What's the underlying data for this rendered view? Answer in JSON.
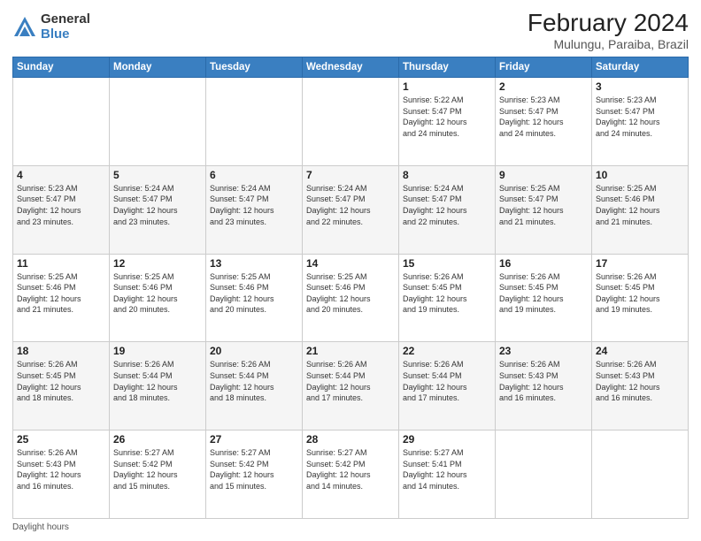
{
  "logo": {
    "general": "General",
    "blue": "Blue"
  },
  "title": {
    "month_year": "February 2024",
    "location": "Mulungu, Paraiba, Brazil"
  },
  "days_of_week": [
    "Sunday",
    "Monday",
    "Tuesday",
    "Wednesday",
    "Thursday",
    "Friday",
    "Saturday"
  ],
  "weeks": [
    [
      {
        "day": "",
        "info": ""
      },
      {
        "day": "",
        "info": ""
      },
      {
        "day": "",
        "info": ""
      },
      {
        "day": "",
        "info": ""
      },
      {
        "day": "1",
        "info": "Sunrise: 5:22 AM\nSunset: 5:47 PM\nDaylight: 12 hours\nand 24 minutes."
      },
      {
        "day": "2",
        "info": "Sunrise: 5:23 AM\nSunset: 5:47 PM\nDaylight: 12 hours\nand 24 minutes."
      },
      {
        "day": "3",
        "info": "Sunrise: 5:23 AM\nSunset: 5:47 PM\nDaylight: 12 hours\nand 24 minutes."
      }
    ],
    [
      {
        "day": "4",
        "info": "Sunrise: 5:23 AM\nSunset: 5:47 PM\nDaylight: 12 hours\nand 23 minutes."
      },
      {
        "day": "5",
        "info": "Sunrise: 5:24 AM\nSunset: 5:47 PM\nDaylight: 12 hours\nand 23 minutes."
      },
      {
        "day": "6",
        "info": "Sunrise: 5:24 AM\nSunset: 5:47 PM\nDaylight: 12 hours\nand 23 minutes."
      },
      {
        "day": "7",
        "info": "Sunrise: 5:24 AM\nSunset: 5:47 PM\nDaylight: 12 hours\nand 22 minutes."
      },
      {
        "day": "8",
        "info": "Sunrise: 5:24 AM\nSunset: 5:47 PM\nDaylight: 12 hours\nand 22 minutes."
      },
      {
        "day": "9",
        "info": "Sunrise: 5:25 AM\nSunset: 5:47 PM\nDaylight: 12 hours\nand 21 minutes."
      },
      {
        "day": "10",
        "info": "Sunrise: 5:25 AM\nSunset: 5:46 PM\nDaylight: 12 hours\nand 21 minutes."
      }
    ],
    [
      {
        "day": "11",
        "info": "Sunrise: 5:25 AM\nSunset: 5:46 PM\nDaylight: 12 hours\nand 21 minutes."
      },
      {
        "day": "12",
        "info": "Sunrise: 5:25 AM\nSunset: 5:46 PM\nDaylight: 12 hours\nand 20 minutes."
      },
      {
        "day": "13",
        "info": "Sunrise: 5:25 AM\nSunset: 5:46 PM\nDaylight: 12 hours\nand 20 minutes."
      },
      {
        "day": "14",
        "info": "Sunrise: 5:25 AM\nSunset: 5:46 PM\nDaylight: 12 hours\nand 20 minutes."
      },
      {
        "day": "15",
        "info": "Sunrise: 5:26 AM\nSunset: 5:45 PM\nDaylight: 12 hours\nand 19 minutes."
      },
      {
        "day": "16",
        "info": "Sunrise: 5:26 AM\nSunset: 5:45 PM\nDaylight: 12 hours\nand 19 minutes."
      },
      {
        "day": "17",
        "info": "Sunrise: 5:26 AM\nSunset: 5:45 PM\nDaylight: 12 hours\nand 19 minutes."
      }
    ],
    [
      {
        "day": "18",
        "info": "Sunrise: 5:26 AM\nSunset: 5:45 PM\nDaylight: 12 hours\nand 18 minutes."
      },
      {
        "day": "19",
        "info": "Sunrise: 5:26 AM\nSunset: 5:44 PM\nDaylight: 12 hours\nand 18 minutes."
      },
      {
        "day": "20",
        "info": "Sunrise: 5:26 AM\nSunset: 5:44 PM\nDaylight: 12 hours\nand 18 minutes."
      },
      {
        "day": "21",
        "info": "Sunrise: 5:26 AM\nSunset: 5:44 PM\nDaylight: 12 hours\nand 17 minutes."
      },
      {
        "day": "22",
        "info": "Sunrise: 5:26 AM\nSunset: 5:44 PM\nDaylight: 12 hours\nand 17 minutes."
      },
      {
        "day": "23",
        "info": "Sunrise: 5:26 AM\nSunset: 5:43 PM\nDaylight: 12 hours\nand 16 minutes."
      },
      {
        "day": "24",
        "info": "Sunrise: 5:26 AM\nSunset: 5:43 PM\nDaylight: 12 hours\nand 16 minutes."
      }
    ],
    [
      {
        "day": "25",
        "info": "Sunrise: 5:26 AM\nSunset: 5:43 PM\nDaylight: 12 hours\nand 16 minutes."
      },
      {
        "day": "26",
        "info": "Sunrise: 5:27 AM\nSunset: 5:42 PM\nDaylight: 12 hours\nand 15 minutes."
      },
      {
        "day": "27",
        "info": "Sunrise: 5:27 AM\nSunset: 5:42 PM\nDaylight: 12 hours\nand 15 minutes."
      },
      {
        "day": "28",
        "info": "Sunrise: 5:27 AM\nSunset: 5:42 PM\nDaylight: 12 hours\nand 14 minutes."
      },
      {
        "day": "29",
        "info": "Sunrise: 5:27 AM\nSunset: 5:41 PM\nDaylight: 12 hours\nand 14 minutes."
      },
      {
        "day": "",
        "info": ""
      },
      {
        "day": "",
        "info": ""
      }
    ]
  ],
  "footer": {
    "note": "Daylight hours"
  }
}
